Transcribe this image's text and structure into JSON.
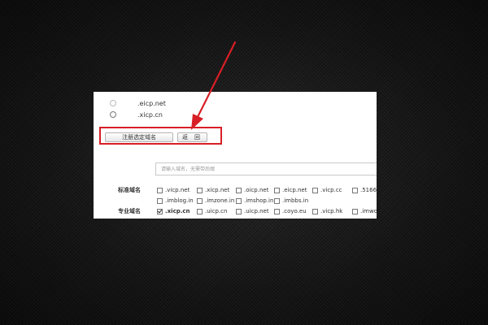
{
  "domain_options": [
    {
      "name": ".eicp.net",
      "selected": false
    },
    {
      "name": ".xicp.cn",
      "selected": false
    }
  ],
  "buttons": {
    "register_label": "注册选定域名",
    "back_label": "返 回"
  },
  "search": {
    "placeholder": "请输入域名，无需带后缀"
  },
  "standard": {
    "label": "标准域名",
    "rows": [
      [
        ".vicp.net",
        ".xicp.net",
        ".oicp.net",
        ".eicp.net",
        ".vicp.cc",
        ".5166"
      ],
      [
        ".imblog.in",
        ".imzone.in",
        ".imshop.in",
        ".imbbs.in"
      ]
    ]
  },
  "professional": {
    "label": "专业域名",
    "items": [
      ".xicp.cn",
      ".uicp.cn",
      ".uicp.net",
      ".coyo.eu",
      ".vicp.hk",
      ".imwo"
    ],
    "checked_index": 0
  },
  "colors": {
    "highlight": "#d81f26",
    "arrow": "#d81f26",
    "background": "#141414",
    "panel": "#ffffff"
  }
}
